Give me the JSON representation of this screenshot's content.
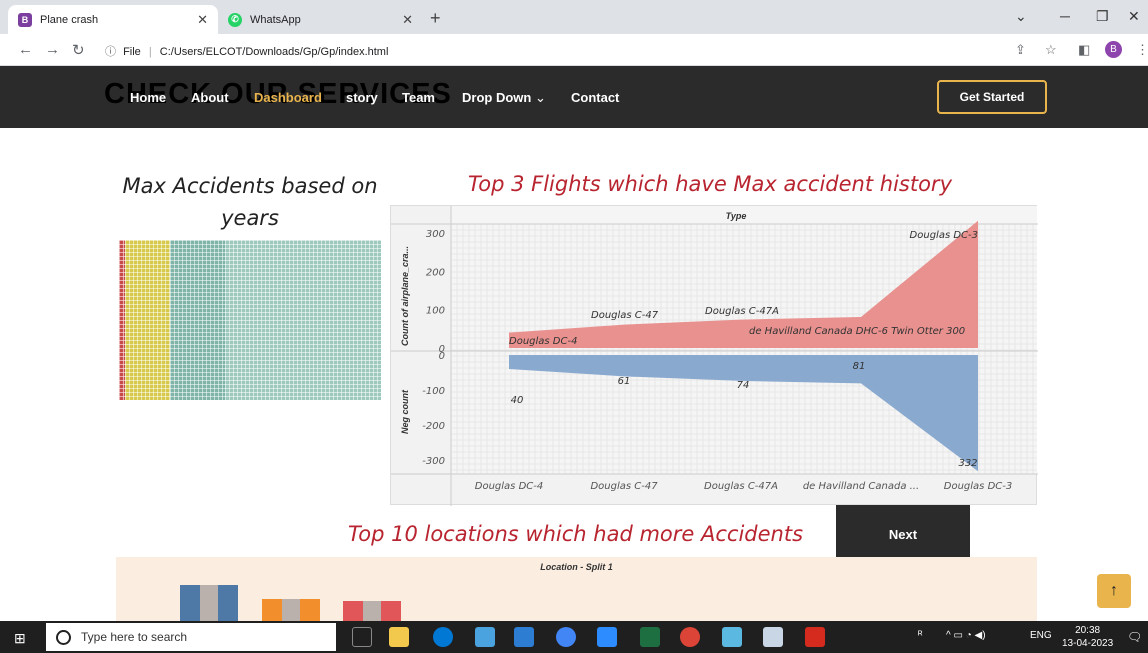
{
  "browser": {
    "tabs": [
      {
        "title": "Plane crash",
        "favicon": "B",
        "color": "#7b3fa0"
      },
      {
        "title": "WhatsApp",
        "favicon": "W",
        "color": "#25d366"
      }
    ],
    "url_label": "File",
    "url": "C:/Users/ELCOT/Downloads/Gp/Gp/index.html",
    "profile_initial": "B"
  },
  "site": {
    "ghost_title": "CHECK OUR SERVICES",
    "nav": [
      "Home",
      "About",
      "Dashboard",
      "story",
      "Team",
      "Drop Down",
      "Contact"
    ],
    "dropdown_caret": "⌄",
    "active": "Dashboard",
    "cta": "Get Started",
    "accent": "#e9b44c"
  },
  "content": {
    "left_heading": "Max Accidents based on years",
    "right_heading": "Top 3 Flights which have Max accident history",
    "bottom_heading": "Top 10 locations which had more Accidents",
    "next_button": "Next",
    "bottom_chart_label": "Location - Split 1",
    "to_top": "↑"
  },
  "chart_data": {
    "type": "area",
    "header": "Type",
    "ylabel_top": "Count of airplane_cra...",
    "ylabel_bottom": "Neg count",
    "categories": [
      "Douglas DC-4",
      "Douglas C-47",
      "Douglas C-47A",
      "de Havilland Canada ...",
      "Douglas DC-3"
    ],
    "top_labels": [
      "Douglas DC-4",
      "Douglas C-47",
      "Douglas C-47A",
      "de Havilland Canada DHC-6 Twin Otter 300",
      "Douglas DC-3"
    ],
    "series": [
      {
        "name": "Count",
        "values": [
          40,
          61,
          74,
          81,
          332
        ],
        "color": "#e8918f"
      },
      {
        "name": "Neg count",
        "values": [
          -40,
          -61,
          -74,
          -81,
          -332
        ],
        "color": "#8aa9cf"
      }
    ],
    "yticks_top": [
      0,
      100,
      200,
      300
    ],
    "yticks_bottom": [
      0,
      -100,
      -200,
      -300
    ],
    "value_labels": [
      "40",
      "61",
      "74",
      "81",
      "332"
    ]
  },
  "taskbar": {
    "search_placeholder": "Type here to search",
    "lang": "ENG",
    "time": "20:38",
    "date": "13-04-2023",
    "notif": "3"
  }
}
